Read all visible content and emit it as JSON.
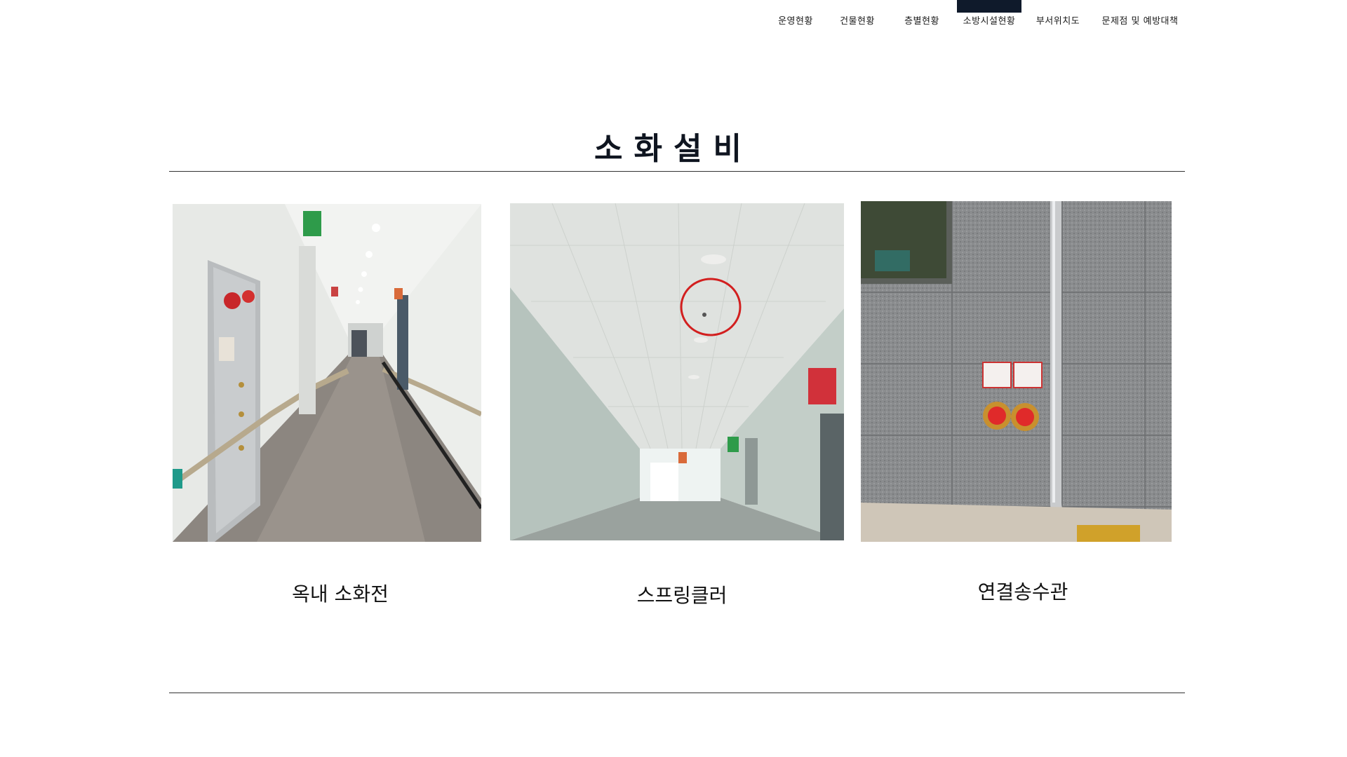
{
  "nav": {
    "items": [
      {
        "label": "운영현황"
      },
      {
        "label": "건물현황"
      },
      {
        "label": "층별현황"
      },
      {
        "label": "소방시설현황",
        "active": true
      },
      {
        "label": "부서위치도"
      },
      {
        "label": "문제점 및 예방대책"
      }
    ],
    "active_color": "#0f1a2b"
  },
  "section": {
    "title": "소화설비"
  },
  "gallery": [
    {
      "caption": "옥내 소화전",
      "icon": "indoor-hydrant-photo"
    },
    {
      "caption": "스프링클러",
      "icon": "sprinkler-photo"
    },
    {
      "caption": "연결송수관",
      "icon": "standpipe-photo"
    }
  ],
  "colors": {
    "heading": "#0f1520",
    "rule": "#333333",
    "highlight_circle": "#d21f1f"
  }
}
